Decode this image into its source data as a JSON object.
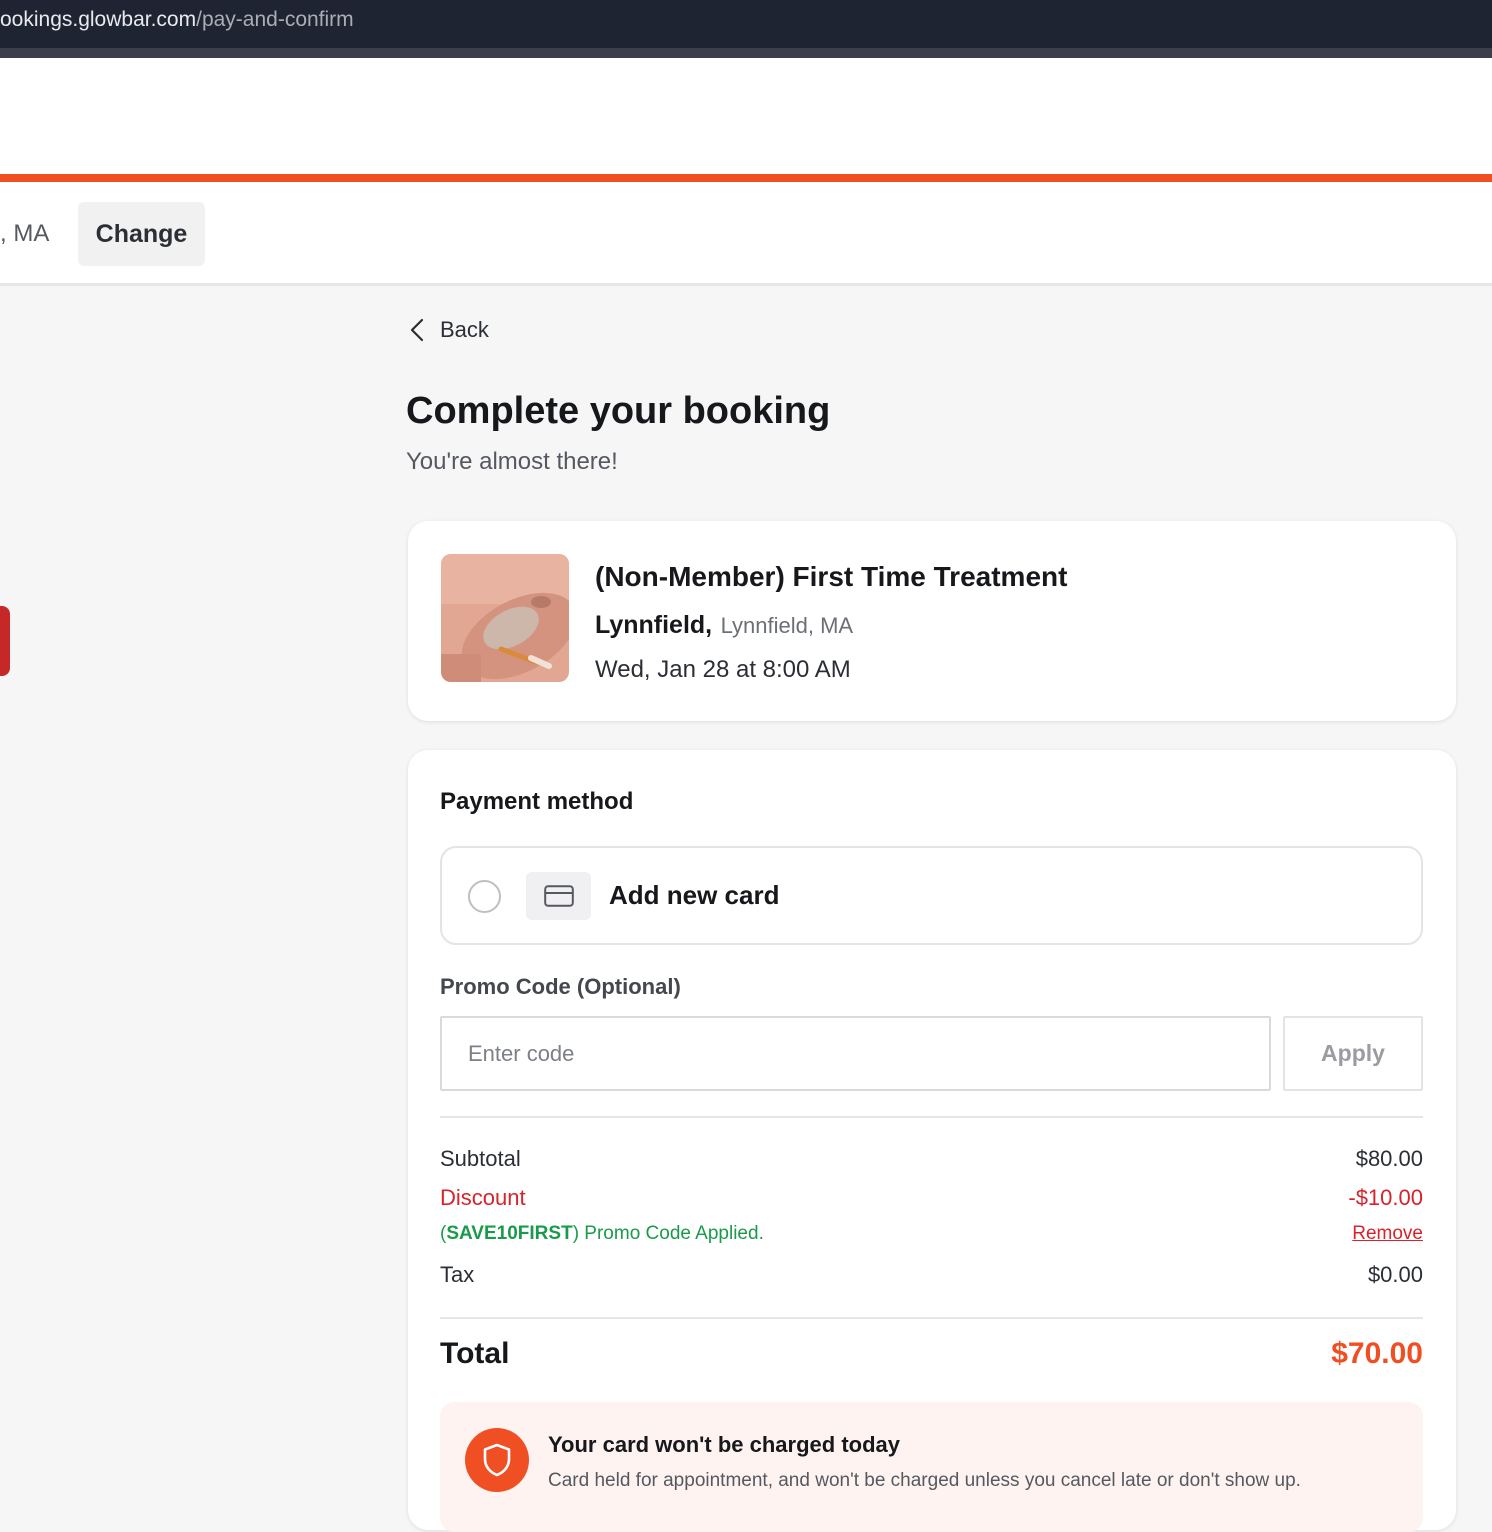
{
  "browser": {
    "url_host": "ookings.glowbar.com",
    "url_path": "/pay-and-confirm"
  },
  "location_bar": {
    "location_text": ", MA",
    "change_label": "Change"
  },
  "nav": {
    "back_label": "Back"
  },
  "page": {
    "title": "Complete your booking",
    "subtitle": "You're almost there!"
  },
  "service": {
    "name": "(Non-Member) First Time Treatment",
    "location_city": "Lynnfield,",
    "location_region": "Lynnfield, MA",
    "datetime": "Wed, Jan 28 at 8:00 AM"
  },
  "payment": {
    "title": "Payment method",
    "add_card_label": "Add new card",
    "promo_label": "Promo Code (Optional)",
    "promo_placeholder": "Enter code",
    "apply_label": "Apply"
  },
  "summary": {
    "subtotal_label": "Subtotal",
    "subtotal_value": "$80.00",
    "discount_label": "Discount",
    "discount_value": "-$10.00",
    "promo_open_paren": "(",
    "promo_code": "SAVE10FIRST",
    "promo_applied_text": ") Promo Code Applied.",
    "remove_label": "Remove",
    "tax_label": "Tax",
    "tax_value": "$0.00",
    "total_label": "Total",
    "total_value": "$70.00"
  },
  "notice": {
    "title": "Your card won't be charged today",
    "body": "Card held for appointment, and won't be charged unless you cancel late or don't show up."
  },
  "colors": {
    "accent": "#f04e23",
    "discount": "#d8232a",
    "promo_success": "#1a9b4b",
    "url_bar_bg": "#1f2433"
  },
  "icons": {
    "back": "chevron-left-icon",
    "card": "credit-card-icon",
    "notice": "shield-icon"
  }
}
